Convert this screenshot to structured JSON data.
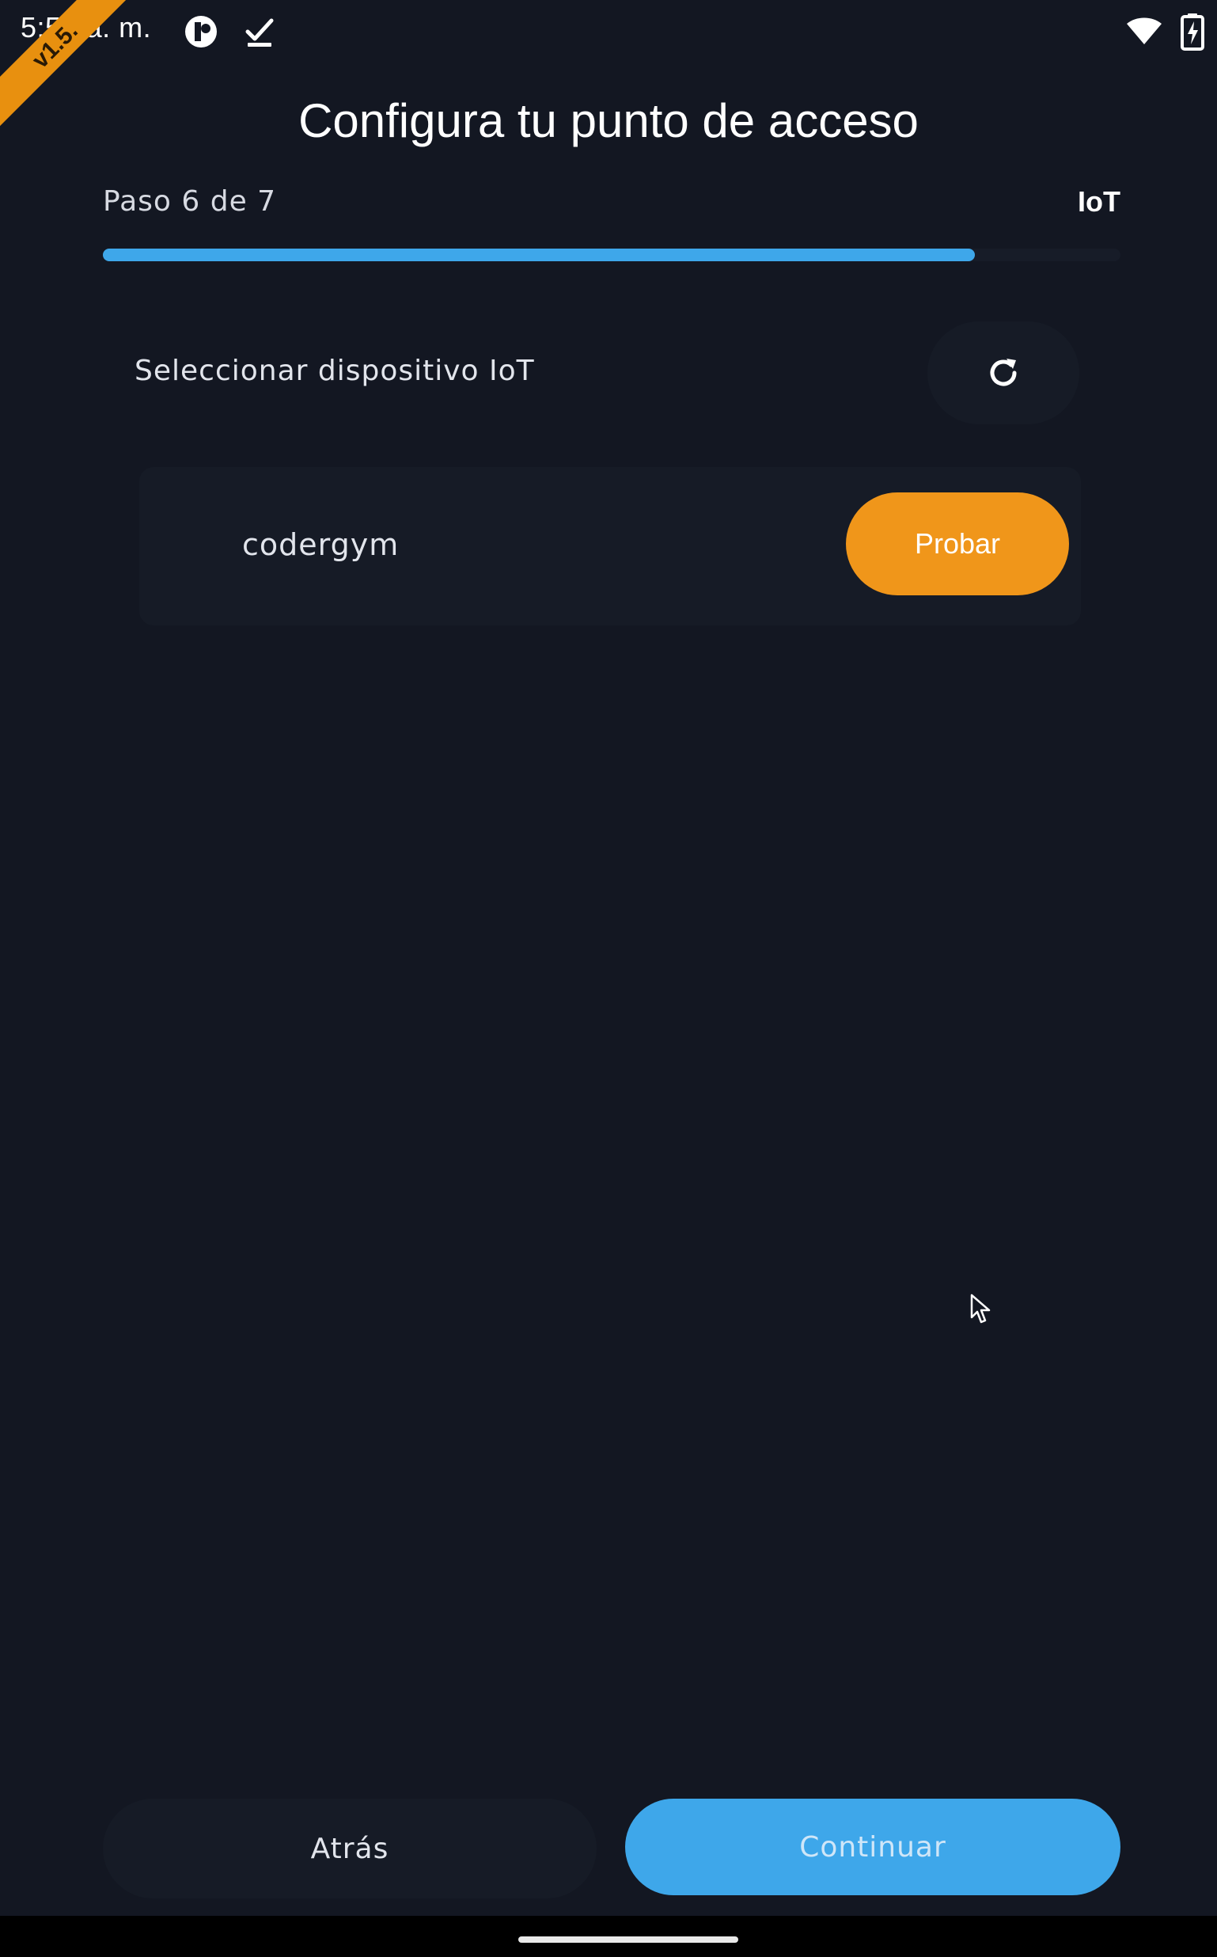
{
  "status_bar": {
    "time": "5:54 a. m.",
    "icons": [
      "app-notification-icon",
      "download-done-icon",
      "wifi-icon",
      "battery-charging-icon"
    ]
  },
  "ribbon": {
    "label": "v1.5."
  },
  "header": {
    "title": "Configura tu punto de acceso",
    "step_text": "Paso 6 de 7",
    "step_tag": "IoT",
    "progress_fraction": 0.857,
    "accent_color": "#3ea7ea"
  },
  "device_section": {
    "label": "Seleccionar dispositivo IoT",
    "refresh_icon": "refresh-icon",
    "devices": [
      {
        "name": "codergym",
        "action_label": "Probar",
        "action_color": "#f0961a"
      }
    ]
  },
  "footer": {
    "back_label": "Atrás",
    "continue_label": "Continuar"
  }
}
